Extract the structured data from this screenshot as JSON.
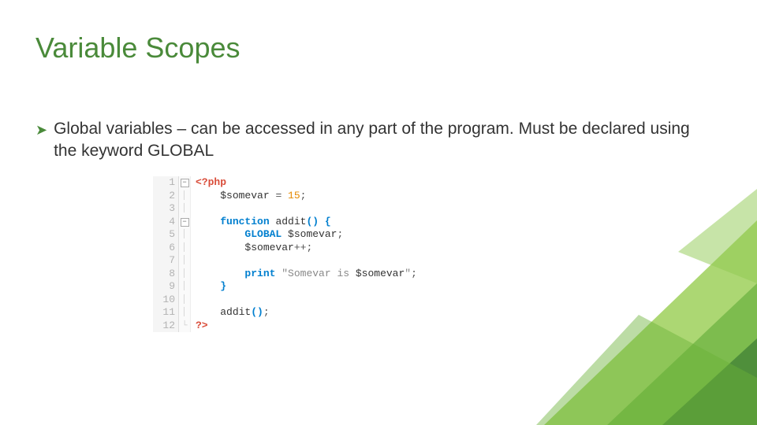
{
  "title": "Variable Scopes",
  "bullet": {
    "text": "Global variables – can be accessed in any part of the program. Must be declared using the keyword GLOBAL"
  },
  "code": {
    "lines": [
      {
        "n": "1",
        "fold": "minus",
        "tokens": [
          {
            "t": "<?",
            "c": "php"
          },
          {
            "t": "php",
            "c": "php"
          }
        ]
      },
      {
        "n": "2",
        "fold": "bar",
        "indent": 4,
        "tokens": [
          {
            "t": "$somevar",
            "c": "var"
          },
          {
            "t": " = ",
            "c": "op"
          },
          {
            "t": "15",
            "c": "num"
          },
          {
            "t": ";",
            "c": "op"
          }
        ]
      },
      {
        "n": "3",
        "fold": "bar",
        "tokens": []
      },
      {
        "n": "4",
        "fold": "minus",
        "indent": 4,
        "tokens": [
          {
            "t": "function",
            "c": "kw"
          },
          {
            "t": " ",
            "c": "op"
          },
          {
            "t": "addit",
            "c": "fn"
          },
          {
            "t": "()",
            "c": "kw"
          },
          {
            "t": " {",
            "c": "kw"
          }
        ]
      },
      {
        "n": "5",
        "fold": "bar",
        "indent": 8,
        "tokens": [
          {
            "t": "GLOBAL",
            "c": "kw"
          },
          {
            "t": " ",
            "c": "op"
          },
          {
            "t": "$somevar",
            "c": "var"
          },
          {
            "t": ";",
            "c": "op"
          }
        ]
      },
      {
        "n": "6",
        "fold": "bar",
        "indent": 8,
        "tokens": [
          {
            "t": "$somevar",
            "c": "var"
          },
          {
            "t": "++;",
            "c": "op"
          }
        ]
      },
      {
        "n": "7",
        "fold": "bar",
        "tokens": []
      },
      {
        "n": "8",
        "fold": "bar",
        "indent": 8,
        "tokens": [
          {
            "t": "print",
            "c": "kw"
          },
          {
            "t": " ",
            "c": "op"
          },
          {
            "t": "\"Somevar is ",
            "c": "str"
          },
          {
            "t": "$somevar",
            "c": "var"
          },
          {
            "t": "\"",
            "c": "str"
          },
          {
            "t": ";",
            "c": "op"
          }
        ]
      },
      {
        "n": "9",
        "fold": "bar",
        "indent": 4,
        "tokens": [
          {
            "t": "}",
            "c": "kw"
          }
        ]
      },
      {
        "n": "10",
        "fold": "bar",
        "tokens": []
      },
      {
        "n": "11",
        "fold": "bar",
        "indent": 4,
        "tokens": [
          {
            "t": "addit",
            "c": "fn"
          },
          {
            "t": "()",
            "c": "kw"
          },
          {
            "t": ";",
            "c": "op"
          }
        ]
      },
      {
        "n": "12",
        "fold": "end",
        "tokens": [
          {
            "t": "?>",
            "c": "php"
          }
        ]
      }
    ]
  },
  "colors": {
    "accent": "#4a8a3a",
    "green_light": "#9ed05a",
    "green_mid": "#78b94a",
    "green_dark": "#4a8a3a"
  }
}
